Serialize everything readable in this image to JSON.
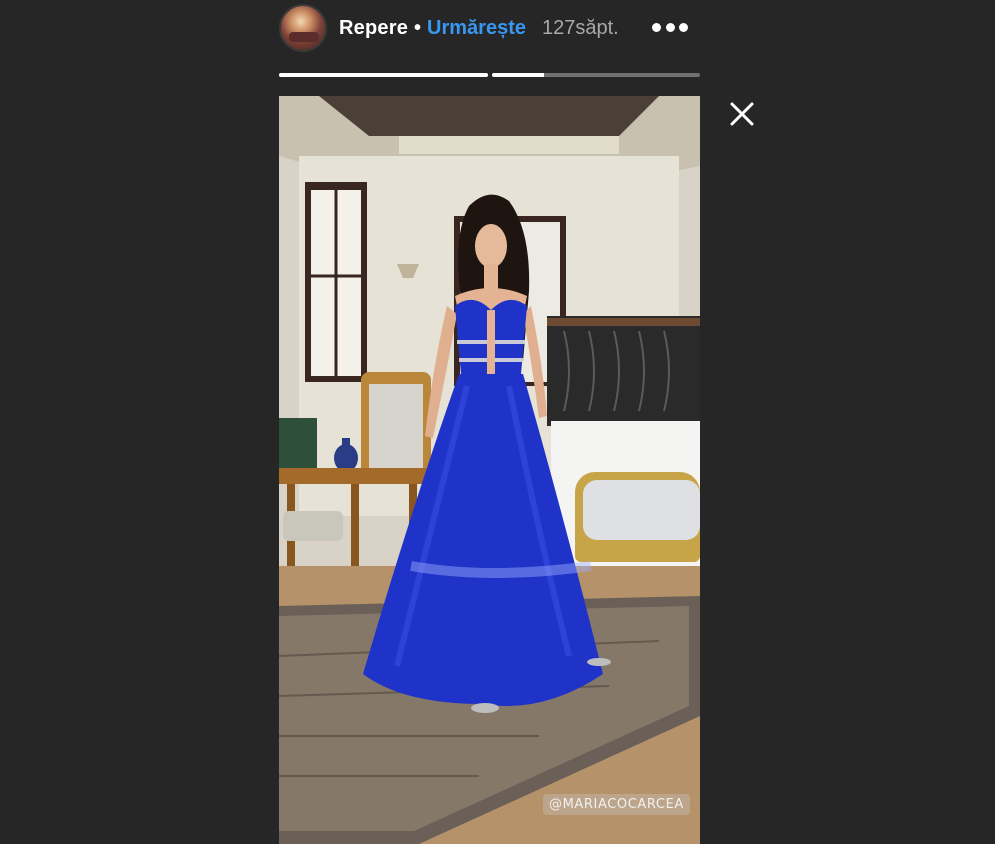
{
  "header": {
    "avatar_label": "",
    "username": "Repere",
    "separator": "•",
    "follow_label": "Urmărește",
    "time": "127săpt."
  },
  "progress": [
    {
      "fill": 1.0
    },
    {
      "fill": 0.25
    }
  ],
  "story": {
    "watermark": "@MARIACOCARCEA",
    "accent_color": "#3897f0",
    "dress_color": "#1f33c9"
  },
  "icons": {
    "more": "more-horizontal-icon",
    "close": "close-icon"
  }
}
